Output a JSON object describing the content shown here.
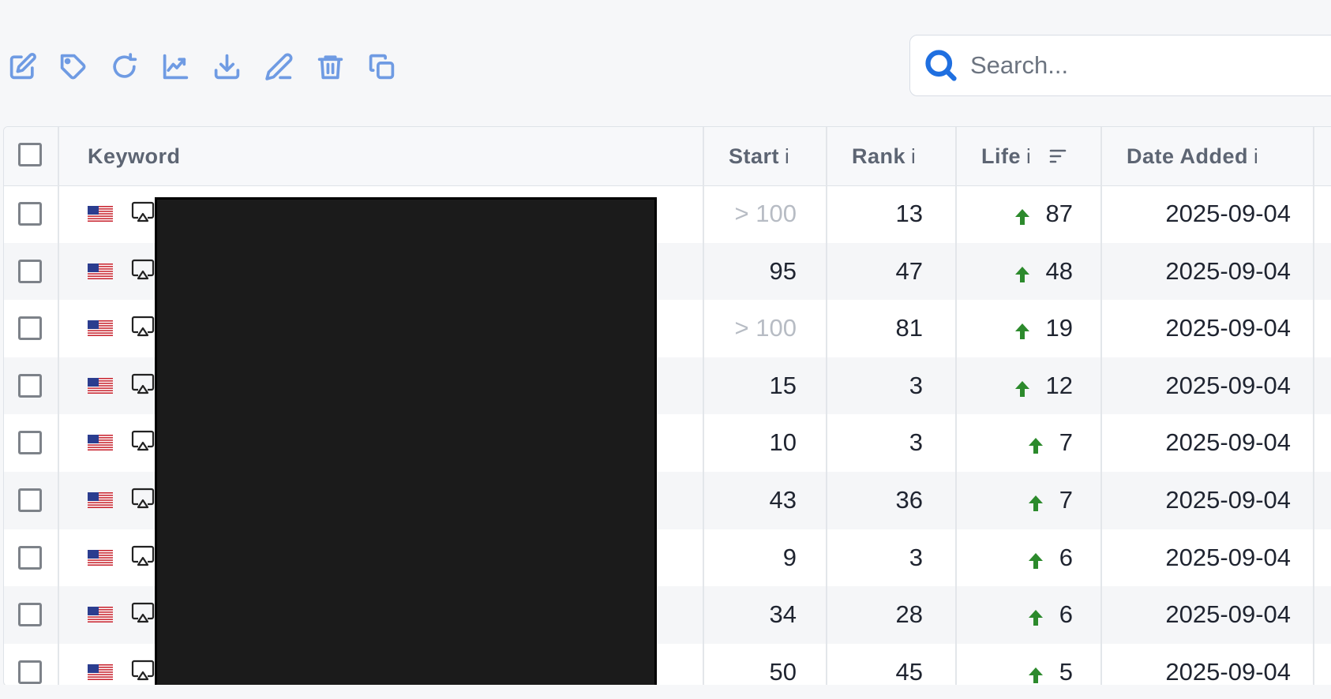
{
  "toolbar": {
    "icons": [
      "edit-icon",
      "tag-icon",
      "refresh-icon",
      "chart-icon",
      "download-icon",
      "pencil-icon",
      "trash-icon",
      "copy-icon"
    ]
  },
  "search": {
    "placeholder": "Search..."
  },
  "colors": {
    "accent": "#1f6fe0",
    "toolbar_icon": "#6f9be3",
    "up_arrow": "#2c8a2c"
  },
  "table": {
    "headers": {
      "keyword": "Keyword",
      "start": "Start",
      "rank": "Rank",
      "life": "Life",
      "date_added": "Date Added",
      "info": "i"
    },
    "rows": [
      {
        "start": "> 100",
        "start_muted": true,
        "rank": "13",
        "life": "87",
        "date": "2025-09-04"
      },
      {
        "start": "95",
        "start_muted": false,
        "rank": "47",
        "life": "48",
        "date": "2025-09-04"
      },
      {
        "start": "> 100",
        "start_muted": true,
        "rank": "81",
        "life": "19",
        "date": "2025-09-04"
      },
      {
        "start": "15",
        "start_muted": false,
        "rank": "3",
        "life": "12",
        "date": "2025-09-04"
      },
      {
        "start": "10",
        "start_muted": false,
        "rank": "3",
        "life": "7",
        "date": "2025-09-04"
      },
      {
        "start": "43",
        "start_muted": false,
        "rank": "36",
        "life": "7",
        "date": "2025-09-04"
      },
      {
        "start": "9",
        "start_muted": false,
        "rank": "3",
        "life": "6",
        "date": "2025-09-04"
      },
      {
        "start": "34",
        "start_muted": false,
        "rank": "28",
        "life": "6",
        "date": "2025-09-04"
      },
      {
        "start": "50",
        "start_muted": false,
        "rank": "45",
        "life": "5",
        "date": "2025-09-04"
      }
    ]
  }
}
